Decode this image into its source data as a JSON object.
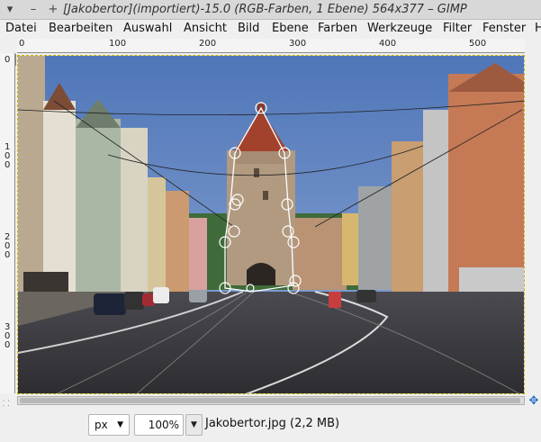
{
  "window": {
    "title": "[Jakobertor](importiert)-15.0 (RGB-Farben, 1 Ebene) 564x377 – GIMP",
    "controls": {
      "menu": "▾",
      "minimize": "–",
      "maximize": "+"
    }
  },
  "menubar": {
    "items": [
      "Datei",
      "Bearbeiten",
      "Auswahl",
      "Ansicht",
      "Bild",
      "Ebene",
      "Farben",
      "Werkzeuge",
      "Filter",
      "Fenster",
      "H"
    ]
  },
  "rulers": {
    "horizontal": [
      "0",
      "100",
      "200",
      "300",
      "400",
      "500"
    ],
    "vertical": [
      "0",
      "100",
      "200",
      "300"
    ]
  },
  "image": {
    "description_icon": "photo-canvas",
    "path_nodes": 17
  },
  "statusbar": {
    "unit": "px",
    "zoom": "100",
    "zoom_unit": "%",
    "file_info": "Jakobertor.jpg (2,2 MB)"
  },
  "icons": {
    "navigate": "navigate-icon",
    "quick_mask": "quick-mask-icon"
  },
  "colors": {
    "sky": "#5a7fbf",
    "path_stroke": "#ffffff",
    "selection_border": "#c8b600"
  }
}
